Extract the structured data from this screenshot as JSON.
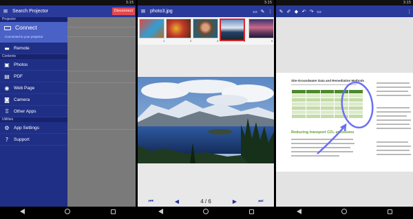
{
  "status": {
    "time": "3:15"
  },
  "projector_panel": {
    "title": "Search Projector",
    "disconnect_label": "Disconnect",
    "section_projector": "Projector",
    "connect_label": "Connect",
    "connect_sub": "Connected to your projector",
    "remote_label": "Remote",
    "section_contents": "Contents",
    "contents": [
      {
        "label": "Photos",
        "icon": "photo-icon"
      },
      {
        "label": "PDF",
        "icon": "pdf-icon"
      },
      {
        "label": "Web Page",
        "icon": "globe-icon"
      },
      {
        "label": "Camera",
        "icon": "camera-icon"
      },
      {
        "label": "Other Apps",
        "icon": "apps-icon"
      }
    ],
    "section_utilities": "Utilities",
    "utilities": [
      {
        "label": "App Settings",
        "icon": "gear-icon"
      },
      {
        "label": "Support",
        "icon": "help-icon"
      }
    ]
  },
  "photo_panel": {
    "title": "photo3.jpg",
    "thumbnails": [
      "1",
      "2",
      "3",
      "4",
      "5"
    ],
    "selected_index": 4,
    "pager_text": "4 / 6"
  },
  "annotation_panel": {
    "doc_heading": "Site-Groundwater Data and Remediation Methods",
    "doc_section_heading": "Reducing transport CO₂ emissions"
  },
  "colors": {
    "toolbar": "#2a3a9b",
    "drawer": "#1f2f86",
    "accent_red": "#e5484d",
    "pen_circle": "#6a6ff0"
  }
}
